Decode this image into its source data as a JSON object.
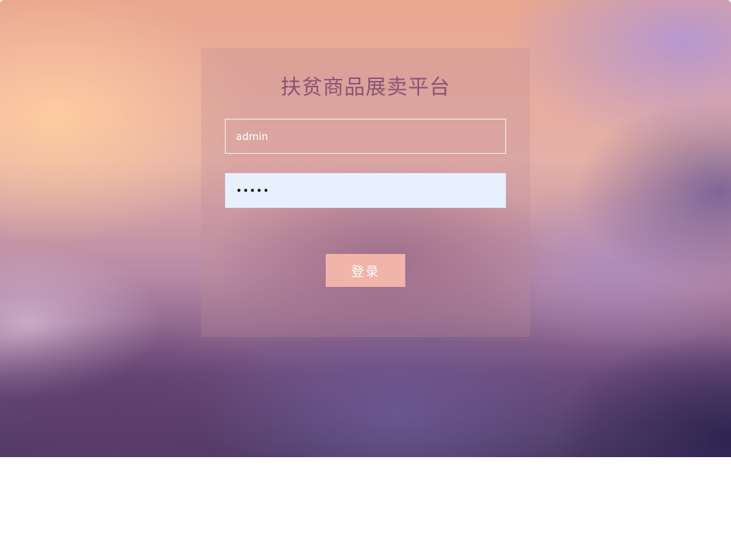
{
  "login": {
    "title": "扶贫商品展卖平台",
    "username_value": "admin",
    "password_value": "•••••",
    "submit_label": "登录"
  },
  "colors": {
    "title": "#8a5377",
    "button_bg": "#f0b4a8",
    "password_bg": "#e8f0fe"
  }
}
